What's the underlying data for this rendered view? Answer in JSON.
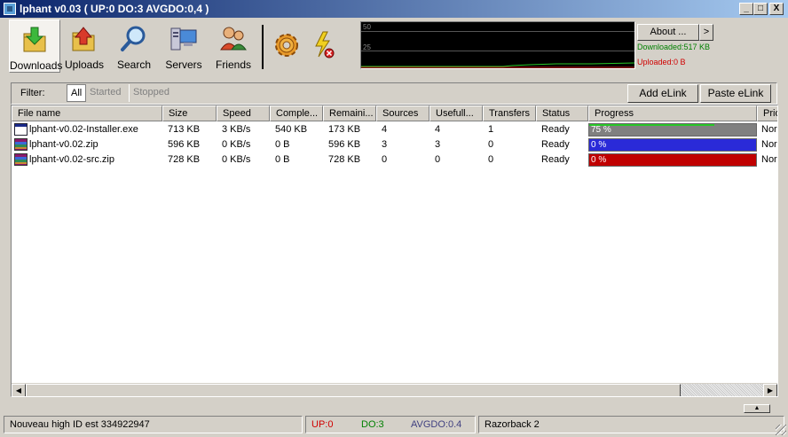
{
  "window": {
    "title": "lphant v0.03 ( UP:0 DO:3 AVGDO:0,4 )",
    "minimize": "_",
    "maximize": "□",
    "close": "X"
  },
  "toolbar": {
    "buttons": [
      {
        "label": "Downloads",
        "icon": "downloads-icon"
      },
      {
        "label": "Uploads",
        "icon": "uploads-icon"
      },
      {
        "label": "Search",
        "icon": "search-icon"
      },
      {
        "label": "Servers",
        "icon": "servers-icon"
      },
      {
        "label": "Friends",
        "icon": "friends-icon"
      }
    ],
    "extra_icons": [
      "preferences-gear-icon",
      "disconnect-lightning-icon"
    ]
  },
  "graph": {
    "label_top": "50",
    "label_mid": "25"
  },
  "about": {
    "label": "About ...",
    "arrow": ">"
  },
  "stats": {
    "downloaded": "Downloaded:517 KB",
    "uploaded": "Uploaded:0 B",
    "download_color": "#008000",
    "upload_color": "#d00000"
  },
  "filter": {
    "label": "Filter:",
    "options": [
      "All",
      "Started",
      "Stopped"
    ],
    "selected": "All"
  },
  "buttons": {
    "add_elink": "Add eLink",
    "paste_elink": "Paste eLink"
  },
  "table": {
    "columns": [
      "File name",
      "Size",
      "Speed",
      "Comple...",
      "Remaini...",
      "Sources",
      "Usefull...",
      "Transfers",
      "Status",
      "Progress",
      "Prio"
    ],
    "rows": [
      {
        "name": "lphant-v0.02-Installer.exe",
        "icon": "exe",
        "size": "713 KB",
        "speed": "3 KB/s",
        "completed": "540 KB",
        "remaining": "173 KB",
        "sources": "4",
        "useful": "4",
        "transfers": "1",
        "status": "Ready",
        "progress_text": "75 %",
        "progress": 0.75,
        "color": "#808080",
        "prio": "Normal"
      },
      {
        "name": "lphant-v0.02.zip",
        "icon": "zip",
        "size": "596 KB",
        "speed": "0 KB/s",
        "completed": "0 B",
        "remaining": "596 KB",
        "sources": "3",
        "useful": "3",
        "transfers": "0",
        "status": "Ready",
        "progress_text": "0 %",
        "progress": 0,
        "color": "#2a2ad8",
        "prio": "Normal"
      },
      {
        "name": "lphant-v0.02-src.zip",
        "icon": "zip",
        "size": "728 KB",
        "speed": "0 KB/s",
        "completed": "0 B",
        "remaining": "728 KB",
        "sources": "0",
        "useful": "0",
        "transfers": "0",
        "status": "Ready",
        "progress_text": "0 %",
        "progress": 0,
        "color": "#c00000",
        "prio": "Normal"
      }
    ]
  },
  "statusbar": {
    "message": "Nouveau high ID est 334922947",
    "up": "UP:0",
    "down": "DO:3",
    "avg": "AVGDO:0.4",
    "server": "Razorback 2",
    "up_color": "#d00000",
    "down_color": "#008000",
    "avg_color": "#404080"
  }
}
